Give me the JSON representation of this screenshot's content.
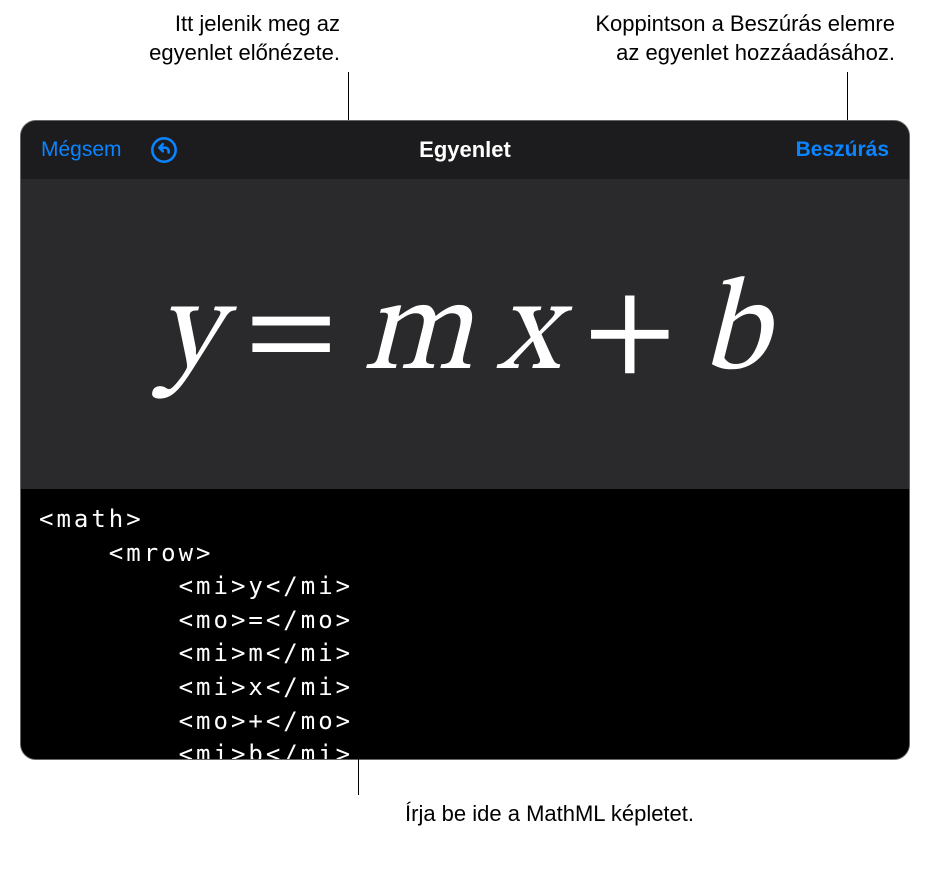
{
  "callouts": {
    "preview": {
      "line1": "Itt jelenik meg az",
      "line2": "egyenlet előnézete."
    },
    "insert": {
      "line1": "Koppintson a Beszúrás elemre",
      "line2": "az egyenlet hozzáadásához."
    },
    "code": "Írja be ide a MathML képletet."
  },
  "toolbar": {
    "cancel_label": "Mégsem",
    "undo_icon": "undo",
    "title": "Egyenlet",
    "insert_label": "Beszúrás"
  },
  "preview": {
    "y": "y",
    "eq": "=",
    "m": "m",
    "x": "x",
    "plus": "+",
    "b": "b"
  },
  "code_text": "<math>\n    <mrow>\n        <mi>y</mi>\n        <mo>=</mo>\n        <mi>m</mi>\n        <mi>x</mi>\n        <mo>+</mo>\n        <mi>b</mi>"
}
